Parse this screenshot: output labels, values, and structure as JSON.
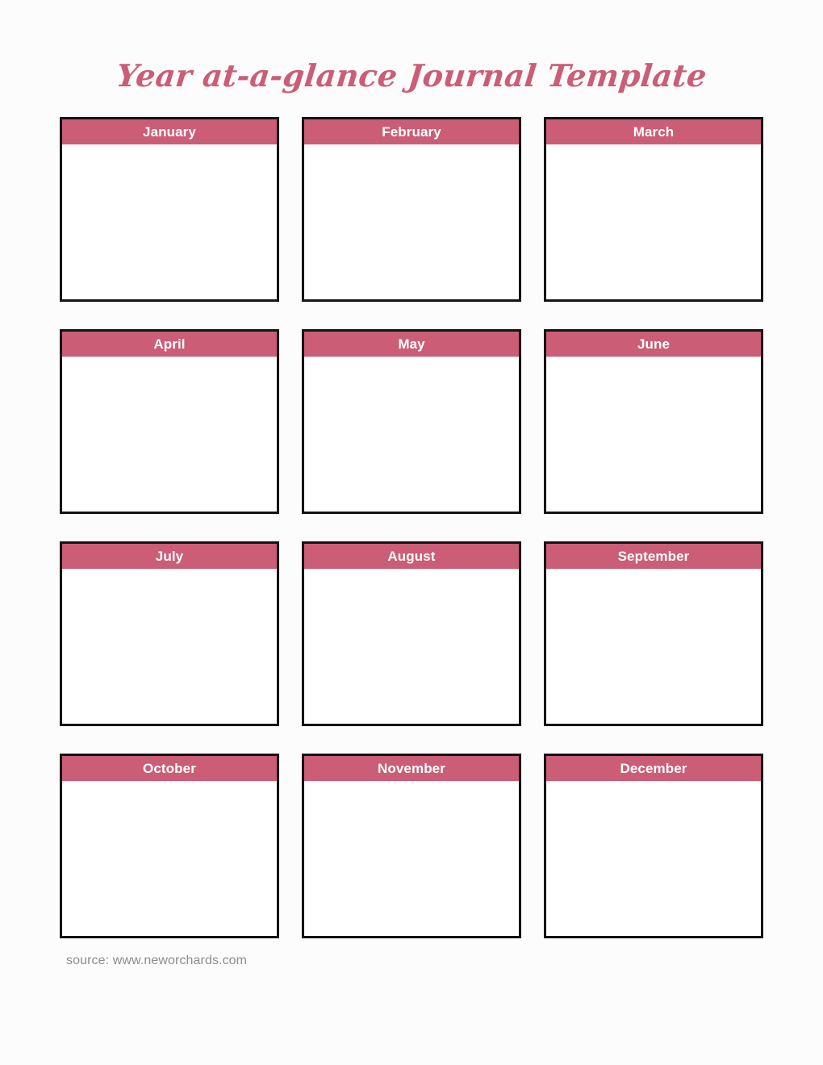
{
  "page": {
    "title": "Year at-a-glance Journal Template",
    "background_color": "#fcfcfc",
    "accent_color": "#cb5d77",
    "border_color": "#141414",
    "header_text_color": "#ffffff"
  },
  "months": [
    {
      "label": "January"
    },
    {
      "label": "February"
    },
    {
      "label": "March"
    },
    {
      "label": "April"
    },
    {
      "label": "May"
    },
    {
      "label": "June"
    },
    {
      "label": "July"
    },
    {
      "label": "August"
    },
    {
      "label": "September"
    },
    {
      "label": "October"
    },
    {
      "label": "November"
    },
    {
      "label": "December"
    }
  ],
  "footer": {
    "source_text": "source: www.neworchards.com"
  }
}
